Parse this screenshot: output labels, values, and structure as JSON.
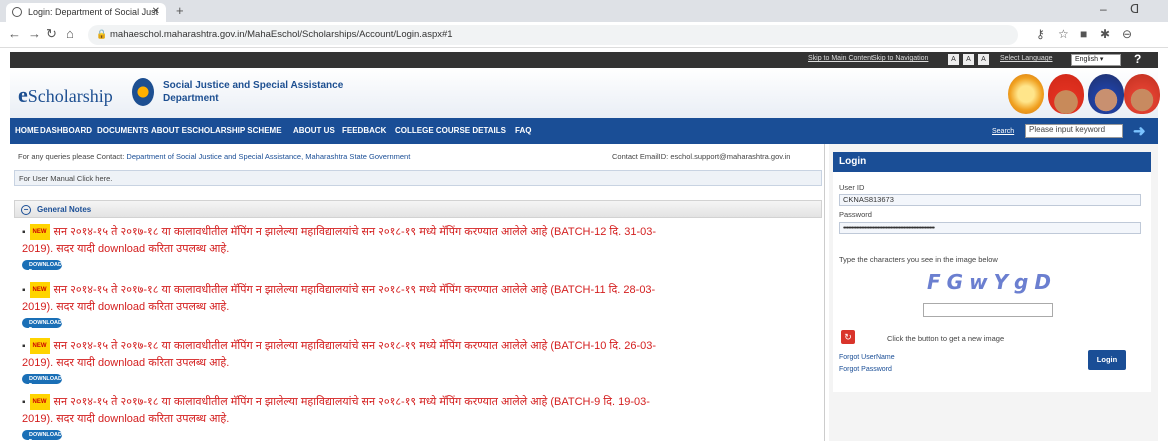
{
  "browser": {
    "tab_title": "Login: Department of Social Just",
    "tab_close": "✕",
    "new_tab": "+",
    "url": "mahaeschol.maharashtra.gov.in/MahaEschol/Scholarships/Account/Login.aspx#1",
    "win_min": "–",
    "win_max": "ᗡ"
  },
  "top": {
    "skip_main": "Skip to Main Content",
    "skip_nav": "Skip to Navigation",
    "font_small": "A",
    "font_med": "A",
    "font_large": "A",
    "select_language": "Select Language",
    "language": "English ▾",
    "help": "?"
  },
  "header": {
    "logo_initial": "e",
    "logo_rest": "Scholarship",
    "dept_line1": "Social Justice and Special Assistance",
    "dept_line2": "Department"
  },
  "menu": {
    "items": [
      "HOME",
      "DASHBOARD",
      "DOCUMENTS",
      "ABOUT ESCHOLARSHIP SCHEME",
      "ABOUT US",
      "FEEDBACK",
      "COLLEGE COURSE DETAILS",
      "FAQ"
    ],
    "search_label": "Search",
    "search_placeholder": "Please input keyword",
    "search_go": "➜"
  },
  "main": {
    "contact_prefix": "For any queries please Contact:",
    "contact_link": "Department of Social Justice and Special Assistance, Maharashtra State Government",
    "contact_email": "Contact EmailID: eschol.support@maharashtra.gov.in",
    "manual": "For User Manual Click here.",
    "notes_title": "General Notes",
    "new_badge": "NEW",
    "download_label": "DOWNLOAD",
    "notes": [
      {
        "line1": "सन २०१४-१५ ते २०१७-१८ या कालावधीतील मॅपिंग न झालेल्या महाविद्यालयांचे सन २०१८-१९ मध्ये मॅपिंग करण्यात आलेले आहे (BATCH-12 दि. 31-03-",
        "line2": "2019). सदर यादी download करिता उपलब्ध आहे."
      },
      {
        "line1": "सन २०१४-१५ ते २०१७-१८ या कालावधीतील मॅपिंग न झालेल्या महाविद्यालयांचे सन २०१८-१९ मध्ये मॅपिंग करण्यात आलेले आहे (BATCH-11 दि. 28-03-",
        "line2": "2019). सदर यादी download करिता उपलब्ध आहे."
      },
      {
        "line1": "सन २०१४-१५ ते २०१७-१८ या कालावधीतील मॅपिंग न झालेल्या महाविद्यालयांचे सन २०१८-१९ मध्ये मॅपिंग करण्यात आलेले आहे (BATCH-10 दि. 26-03-",
        "line2": "2019). सदर यादी download करिता उपलब्ध आहे."
      },
      {
        "line1": "सन २०१४-१५ ते २०१७-१८ या कालावधीतील मॅपिंग न झालेल्या महाविद्यालयांचे सन २०१८-१९ मध्ये मॅपिंग करण्यात आलेले आहे (BATCH-9 दि. 19-03-",
        "line2": "2019). सदर यादी download करिता उपलब्ध आहे."
      }
    ]
  },
  "login": {
    "title": "Login",
    "user_id_label": "User ID",
    "user_id_value": "CKNAS813673",
    "password_label": "Password",
    "password_value": "••••••••••••••••••••••••••••••••••••••••••••••••••••••••",
    "captcha_prompt": "Type the characters you see in the image below",
    "captcha_text": "FGwYgD",
    "refresh_hint": "Click the button to get a new image",
    "forgot_user": "Forgot UserName",
    "forgot_password": "Forgot Password",
    "login_button": "Login"
  },
  "colors": {
    "menu_bg": "#1a4e96",
    "note_red": "#d42020"
  }
}
